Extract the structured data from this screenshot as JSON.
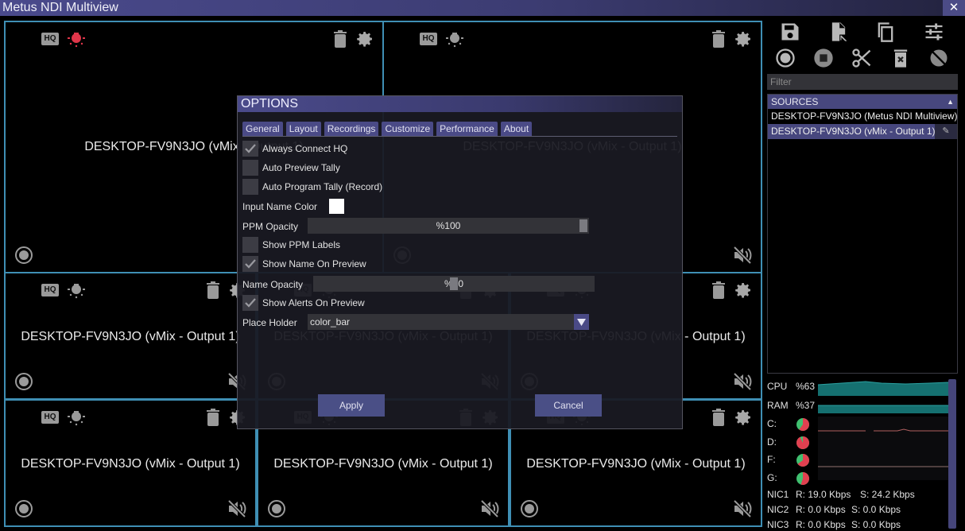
{
  "window": {
    "title": "Metus NDI Multiview",
    "close_glyph": "✕"
  },
  "tiles": [
    {
      "name": "DESKTOP-FV9N3JO (vMix - Output 1)",
      "tally_active": true,
      "muted": false
    },
    {
      "name": "DESKTOP-FV9N3JO (vMix - Output 1)",
      "tally_active": false,
      "muted": true
    },
    {
      "name": "DESKTOP-FV9N3JO (vMix - Output 1)",
      "tally_active": false,
      "muted": true
    },
    {
      "name": "DESKTOP-FV9N3JO (vMix - Output 1)",
      "tally_active": false,
      "muted": true
    },
    {
      "name": "DESKTOP-FV9N3JO (vMix - Output 1)",
      "tally_active": false,
      "muted": true
    },
    {
      "name": "DESKTOP-FV9N3JO (vMix - Output 1)",
      "tally_active": false,
      "muted": true
    },
    {
      "name": "DESKTOP-FV9N3JO (vMix - Output 1)",
      "tally_active": false,
      "muted": true
    },
    {
      "name": "DESKTOP-FV9N3JO (vMix - Output 1)",
      "tally_active": false,
      "muted": true
    }
  ],
  "tile_badge": "HQ",
  "toolbar": {
    "row1": [
      "save-icon",
      "import-file-icon",
      "copy-icon",
      "settings-sliders-icon"
    ],
    "row2": [
      "record-icon",
      "stop-icon",
      "scissors-icon",
      "delete-all-icon",
      "hide-icon"
    ]
  },
  "filter": {
    "placeholder": "Filter",
    "value": ""
  },
  "sources": {
    "header": "SOURCES",
    "items": [
      {
        "label": "DESKTOP-FV9N3JO (Metus NDI Multiview)",
        "selected": false
      },
      {
        "label": "DESKTOP-FV9N3JO (vMix - Output 1)",
        "selected": true
      }
    ]
  },
  "stats": {
    "cpu": {
      "label": "CPU",
      "value": "%63"
    },
    "ram": {
      "label": "RAM",
      "value": "%37"
    },
    "drives": [
      {
        "label": "C:",
        "used_fraction": 0.6
      },
      {
        "label": "D:",
        "used_fraction": 0.93
      },
      {
        "label": "F:",
        "used_fraction": 0.65
      },
      {
        "label": "G:",
        "used_fraction": 0.55
      }
    ],
    "nics": [
      {
        "label": "NIC1",
        "recv": "R: 19.0 Kbps",
        "send": "S: 24.2 Kbps"
      },
      {
        "label": "NIC2",
        "recv": "R: 0.0 Kbps",
        "send": "S: 0.0 Kbps"
      },
      {
        "label": "NIC3",
        "recv": "R: 0.0 Kbps",
        "send": "S: 0.0 Kbps"
      }
    ],
    "colors": {
      "cpu_ram": "#1a7a7a",
      "drive_used": "#e04050",
      "drive_free": "#40c070"
    }
  },
  "options": {
    "title": "OPTIONS",
    "tabs": [
      "General",
      "Layout",
      "Recordings",
      "Customize",
      "Performance",
      "About"
    ],
    "always_connect_hq": {
      "label": "Always Connect HQ",
      "checked": true
    },
    "auto_preview_tally": {
      "label": "Auto Preview Tally",
      "checked": false
    },
    "auto_program_tally": {
      "label": "Auto Program Tally (Record)",
      "checked": false
    },
    "input_name_color": {
      "label": "Input Name Color",
      "color": "#ffffff"
    },
    "ppm_opacity": {
      "label": "PPM Opacity",
      "display": "%100",
      "value": 100
    },
    "show_ppm_labels": {
      "label": "Show PPM Labels",
      "checked": false
    },
    "show_name_on_preview": {
      "label": "Show Name On Preview",
      "checked": true
    },
    "name_opacity": {
      "label": "Name Opacity",
      "display": "%50",
      "value": 50
    },
    "show_alerts_on_preview": {
      "label": "Show Alerts On Preview",
      "checked": true
    },
    "place_holder": {
      "label": "Place Holder",
      "value": "color_bar"
    },
    "apply_label": "Apply",
    "cancel_label": "Cancel"
  }
}
